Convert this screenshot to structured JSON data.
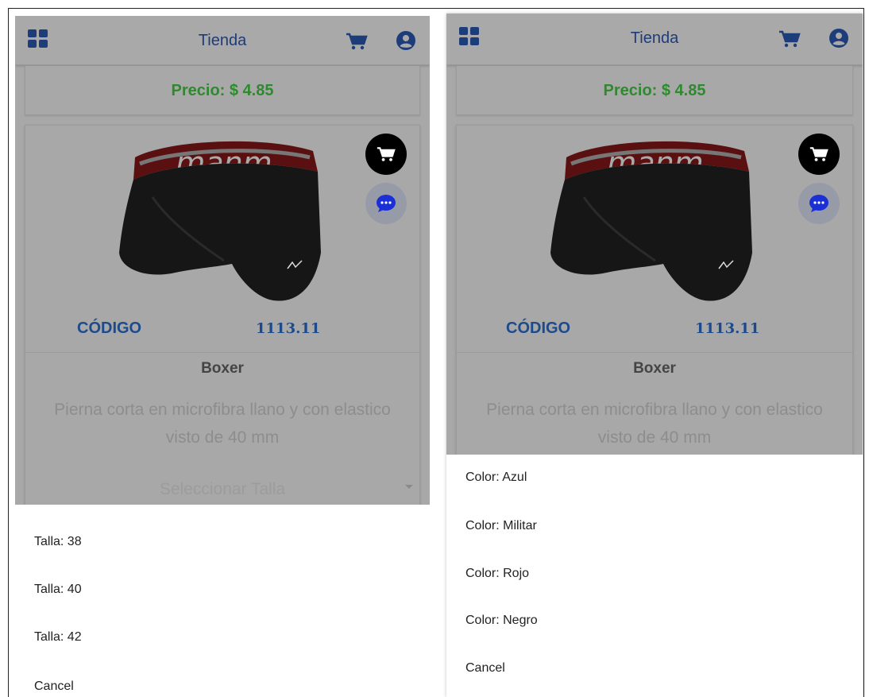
{
  "panels": [
    {
      "appbar": {
        "title": "Tienda"
      },
      "price": "Precio: $ 4.85",
      "product": {
        "codigo_label": "CÓDIGO",
        "codigo_value": "1113.11",
        "name": "Boxer",
        "description": "Pierna corta en microfibra llano y con elastico visto de 40 mm",
        "select_placeholder": "Seleccionar Talla"
      },
      "sheet": {
        "options": [
          "Talla: 38",
          "Talla: 40",
          "Talla: 42"
        ],
        "cancel": "Cancel"
      }
    },
    {
      "appbar": {
        "title": "Tienda"
      },
      "price": "Precio: $ 4.85",
      "product": {
        "codigo_label": "CÓDIGO",
        "codigo_value": "1113.11",
        "name": "Boxer",
        "description": "Pierna corta en microfibra llano y con elastico visto de 40 mm"
      },
      "sheet": {
        "options": [
          "Color: Azul",
          "Color: Militar",
          "Color: Rojo",
          "Color: Negro"
        ],
        "cancel": "Cancel"
      }
    }
  ],
  "icons": {
    "menu": "grid-icon",
    "cart": "cart-icon",
    "account": "user-circle-icon",
    "chat": "chat-bubble-icon",
    "dropdown": "caret-down-icon"
  },
  "colors": {
    "brand_blue": "#1d3c7a",
    "price_green": "#2f8a2f",
    "overlay_gray": "#a8a8a8",
    "chat_blue": "#1a2fd6"
  }
}
